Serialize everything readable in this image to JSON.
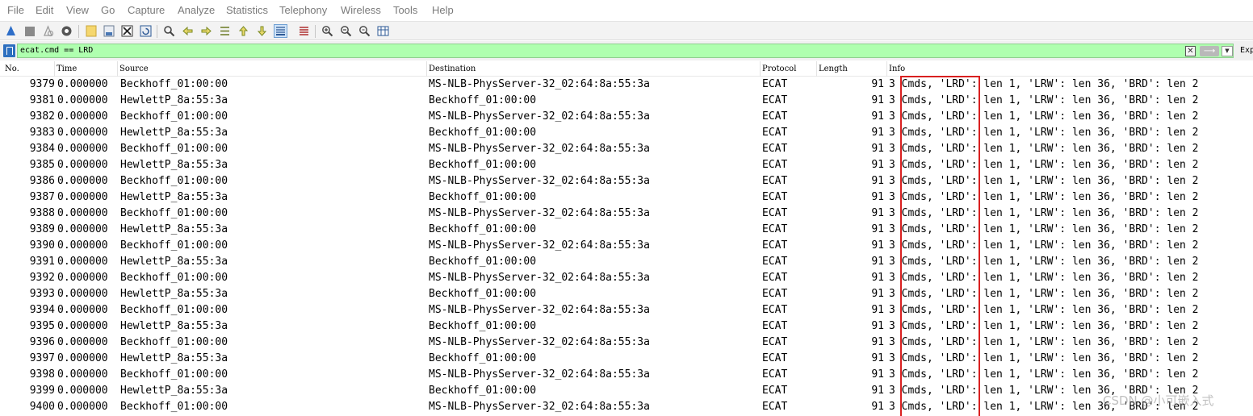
{
  "menu": [
    "File",
    "Edit",
    "View",
    "Go",
    "Capture",
    "Analyze",
    "Statistics",
    "Telephony",
    "Wireless",
    "Tools",
    "Help"
  ],
  "toolbar": {
    "icons": [
      "start-capture-icon",
      "stop-capture-icon",
      "restart-capture-icon",
      "capture-options-icon",
      "open-file-icon",
      "save-file-icon",
      "close-file-icon",
      "reload-file-icon",
      "find-packet-icon",
      "go-back-icon",
      "go-forward-icon",
      "go-to-packet-icon",
      "first-packet-icon",
      "last-packet-icon",
      "autoscroll-icon",
      "colorize-icon",
      "zoom-in-icon",
      "zoom-out-icon",
      "normal-size-icon",
      "resize-columns-icon"
    ]
  },
  "filter": {
    "value": "ecat.cmd == LRD",
    "expression_label": "Exp"
  },
  "columns": {
    "no": "No.",
    "time": "Time",
    "source": "Source",
    "destination": "Destination",
    "protocol": "Protocol",
    "length": "Length",
    "info": "Info"
  },
  "packets": [
    {
      "no": "9379",
      "time": "0.000000",
      "source": "Beckhoff_01:00:00",
      "destination": "MS-NLB-PhysServer-32_02:64:8a:55:3a",
      "protocol": "ECAT",
      "length": "91",
      "info": "3 Cmds, 'LRD': len 1, 'LRW': len 36, 'BRD': len 2"
    },
    {
      "no": "9381",
      "time": "0.000000",
      "source": "HewlettP_8a:55:3a",
      "destination": "Beckhoff_01:00:00",
      "protocol": "ECAT",
      "length": "91",
      "info": "3 Cmds, 'LRD': len 1, 'LRW': len 36, 'BRD': len 2"
    },
    {
      "no": "9382",
      "time": "0.000000",
      "source": "Beckhoff_01:00:00",
      "destination": "MS-NLB-PhysServer-32_02:64:8a:55:3a",
      "protocol": "ECAT",
      "length": "91",
      "info": "3 Cmds, 'LRD': len 1, 'LRW': len 36, 'BRD': len 2"
    },
    {
      "no": "9383",
      "time": "0.000000",
      "source": "HewlettP_8a:55:3a",
      "destination": "Beckhoff_01:00:00",
      "protocol": "ECAT",
      "length": "91",
      "info": "3 Cmds, 'LRD': len 1, 'LRW': len 36, 'BRD': len 2"
    },
    {
      "no": "9384",
      "time": "0.000000",
      "source": "Beckhoff_01:00:00",
      "destination": "MS-NLB-PhysServer-32_02:64:8a:55:3a",
      "protocol": "ECAT",
      "length": "91",
      "info": "3 Cmds, 'LRD': len 1, 'LRW': len 36, 'BRD': len 2"
    },
    {
      "no": "9385",
      "time": "0.000000",
      "source": "HewlettP_8a:55:3a",
      "destination": "Beckhoff_01:00:00",
      "protocol": "ECAT",
      "length": "91",
      "info": "3 Cmds, 'LRD': len 1, 'LRW': len 36, 'BRD': len 2"
    },
    {
      "no": "9386",
      "time": "0.000000",
      "source": "Beckhoff_01:00:00",
      "destination": "MS-NLB-PhysServer-32_02:64:8a:55:3a",
      "protocol": "ECAT",
      "length": "91",
      "info": "3 Cmds, 'LRD': len 1, 'LRW': len 36, 'BRD': len 2"
    },
    {
      "no": "9387",
      "time": "0.000000",
      "source": "HewlettP_8a:55:3a",
      "destination": "Beckhoff_01:00:00",
      "protocol": "ECAT",
      "length": "91",
      "info": "3 Cmds, 'LRD': len 1, 'LRW': len 36, 'BRD': len 2"
    },
    {
      "no": "9388",
      "time": "0.000000",
      "source": "Beckhoff_01:00:00",
      "destination": "MS-NLB-PhysServer-32_02:64:8a:55:3a",
      "protocol": "ECAT",
      "length": "91",
      "info": "3 Cmds, 'LRD': len 1, 'LRW': len 36, 'BRD': len 2"
    },
    {
      "no": "9389",
      "time": "0.000000",
      "source": "HewlettP_8a:55:3a",
      "destination": "Beckhoff_01:00:00",
      "protocol": "ECAT",
      "length": "91",
      "info": "3 Cmds, 'LRD': len 1, 'LRW': len 36, 'BRD': len 2"
    },
    {
      "no": "9390",
      "time": "0.000000",
      "source": "Beckhoff_01:00:00",
      "destination": "MS-NLB-PhysServer-32_02:64:8a:55:3a",
      "protocol": "ECAT",
      "length": "91",
      "info": "3 Cmds, 'LRD': len 1, 'LRW': len 36, 'BRD': len 2"
    },
    {
      "no": "9391",
      "time": "0.000000",
      "source": "HewlettP_8a:55:3a",
      "destination": "Beckhoff_01:00:00",
      "protocol": "ECAT",
      "length": "91",
      "info": "3 Cmds, 'LRD': len 1, 'LRW': len 36, 'BRD': len 2"
    },
    {
      "no": "9392",
      "time": "0.000000",
      "source": "Beckhoff_01:00:00",
      "destination": "MS-NLB-PhysServer-32_02:64:8a:55:3a",
      "protocol": "ECAT",
      "length": "91",
      "info": "3 Cmds, 'LRD': len 1, 'LRW': len 36, 'BRD': len 2"
    },
    {
      "no": "9393",
      "time": "0.000000",
      "source": "HewlettP_8a:55:3a",
      "destination": "Beckhoff_01:00:00",
      "protocol": "ECAT",
      "length": "91",
      "info": "3 Cmds, 'LRD': len 1, 'LRW': len 36, 'BRD': len 2"
    },
    {
      "no": "9394",
      "time": "0.000000",
      "source": "Beckhoff_01:00:00",
      "destination": "MS-NLB-PhysServer-32_02:64:8a:55:3a",
      "protocol": "ECAT",
      "length": "91",
      "info": "3 Cmds, 'LRD': len 1, 'LRW': len 36, 'BRD': len 2"
    },
    {
      "no": "9395",
      "time": "0.000000",
      "source": "HewlettP_8a:55:3a",
      "destination": "Beckhoff_01:00:00",
      "protocol": "ECAT",
      "length": "91",
      "info": "3 Cmds, 'LRD': len 1, 'LRW': len 36, 'BRD': len 2"
    },
    {
      "no": "9396",
      "time": "0.000000",
      "source": "Beckhoff_01:00:00",
      "destination": "MS-NLB-PhysServer-32_02:64:8a:55:3a",
      "protocol": "ECAT",
      "length": "91",
      "info": "3 Cmds, 'LRD': len 1, 'LRW': len 36, 'BRD': len 2"
    },
    {
      "no": "9397",
      "time": "0.000000",
      "source": "HewlettP_8a:55:3a",
      "destination": "Beckhoff_01:00:00",
      "protocol": "ECAT",
      "length": "91",
      "info": "3 Cmds, 'LRD': len 1, 'LRW': len 36, 'BRD': len 2"
    },
    {
      "no": "9398",
      "time": "0.000000",
      "source": "Beckhoff_01:00:00",
      "destination": "MS-NLB-PhysServer-32_02:64:8a:55:3a",
      "protocol": "ECAT",
      "length": "91",
      "info": "3 Cmds, 'LRD': len 1, 'LRW': len 36, 'BRD': len 2"
    },
    {
      "no": "9399",
      "time": "0.000000",
      "source": "HewlettP_8a:55:3a",
      "destination": "Beckhoff_01:00:00",
      "protocol": "ECAT",
      "length": "91",
      "info": "3 Cmds, 'LRD': len 1, 'LRW': len 36, 'BRD': len 2"
    },
    {
      "no": "9400",
      "time": "0.000000",
      "source": "Beckhoff_01:00:00",
      "destination": "MS-NLB-PhysServer-32_02:64:8a:55:3a",
      "protocol": "ECAT",
      "length": "91",
      "info": "3 Cmds, 'LRD': len 1, 'LRW': len 36, 'BRD': len 2"
    }
  ],
  "watermark": "CSDN @小可嵌入式",
  "colors": {
    "filter_valid_bg": "#afffaf",
    "highlight_border": "#d92020",
    "menu_text": "#7a7a7a"
  }
}
